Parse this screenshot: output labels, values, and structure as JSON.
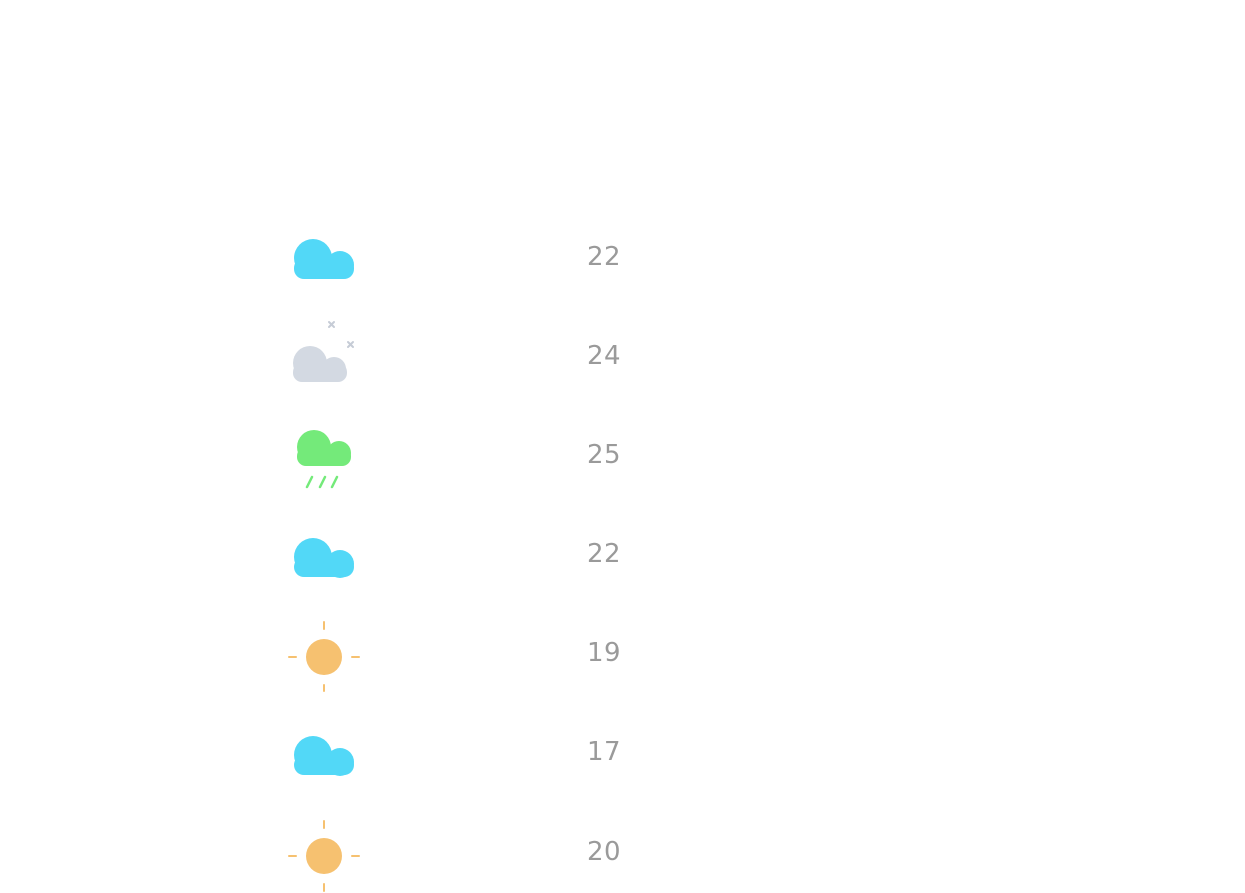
{
  "forecast": {
    "days": [
      {
        "icon": "cloud-icon",
        "temp": "22"
      },
      {
        "icon": "snow-cloud-icon",
        "temp": "24"
      },
      {
        "icon": "rain-cloud-icon",
        "temp": "25"
      },
      {
        "icon": "cloud-icon",
        "temp": "22"
      },
      {
        "icon": "sun-icon",
        "temp": "19"
      },
      {
        "icon": "cloud-icon",
        "temp": "17"
      },
      {
        "icon": "sun-icon",
        "temp": "20"
      }
    ]
  },
  "colors": {
    "cloud": "#52d8f7",
    "snow_cloud": "#d3d9e2",
    "snow_flake": "#c6ccd6",
    "rain_cloud": "#74ea7a",
    "rain_drop": "#74ea7a",
    "sun": "#f6c170",
    "sun_ray": "#f6c170",
    "temp_text": "#9a9a9a"
  }
}
